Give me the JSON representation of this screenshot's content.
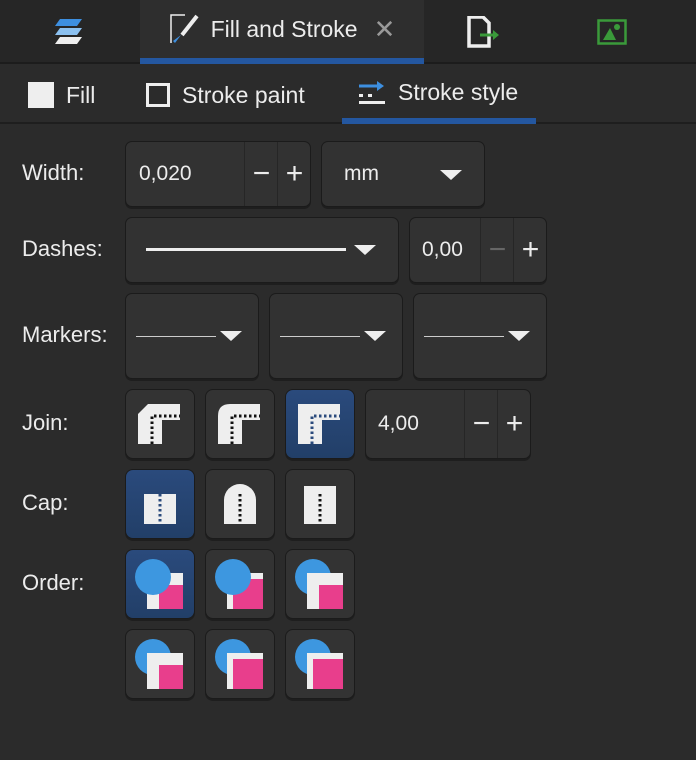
{
  "dialog_tab": {
    "title": "Fill and Stroke"
  },
  "subtabs": [
    {
      "label": "Fill"
    },
    {
      "label": "Stroke paint"
    },
    {
      "label": "Stroke style"
    }
  ],
  "width": {
    "label": "Width:",
    "value": "0,020",
    "unit": "mm"
  },
  "dashes": {
    "label": "Dashes:",
    "offset": "0,00"
  },
  "markers": {
    "label": "Markers:"
  },
  "join": {
    "label": "Join:",
    "selected": "miter",
    "miter_limit": "4,00"
  },
  "cap": {
    "label": "Cap:",
    "selected": "butt"
  },
  "order": {
    "label": "Order:",
    "selected": 0
  },
  "colors": {
    "accent": "#2457a0",
    "active_button": "#2a4a7c",
    "circle": "#3d97e0",
    "square": "#e83e8c",
    "export_green": "#3a9a3a"
  }
}
